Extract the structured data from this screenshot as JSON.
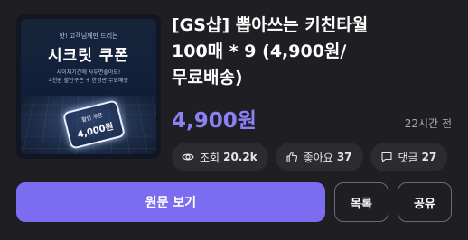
{
  "thumbnail": {
    "top_text": "핫! 고객님께만 드리는",
    "title": "시크릿 쿠폰",
    "sub_line1": "사이지기간에 사두면좋아요!",
    "sub_line2": "4천원 할인쿠폰 + 한정판 무료배송",
    "coupon_small": "할인 쿠폰",
    "coupon_amount": "4,000원"
  },
  "deal": {
    "title": "[GS샵] 뽑아쓰는 키친타월\n100매 * 9 (4,900원/\n무료배송)",
    "price": "4,900원",
    "time_ago": "22시간 전"
  },
  "stats": {
    "views_label": "조회",
    "views_value": "20.2k",
    "likes_label": "좋아요",
    "likes_value": "37",
    "comments_label": "댓글",
    "comments_value": "27"
  },
  "actions": {
    "primary_label": "원문 보기",
    "list_label": "목록",
    "share_label": "공유"
  },
  "colors": {
    "background": "#1f1f23",
    "accent": "#7b6cf0",
    "price": "#8b80f4",
    "pill": "#2b2b30"
  },
  "icons": {
    "views": "eye-icon",
    "likes": "thumbs-up-icon",
    "comments": "comment-icon"
  }
}
